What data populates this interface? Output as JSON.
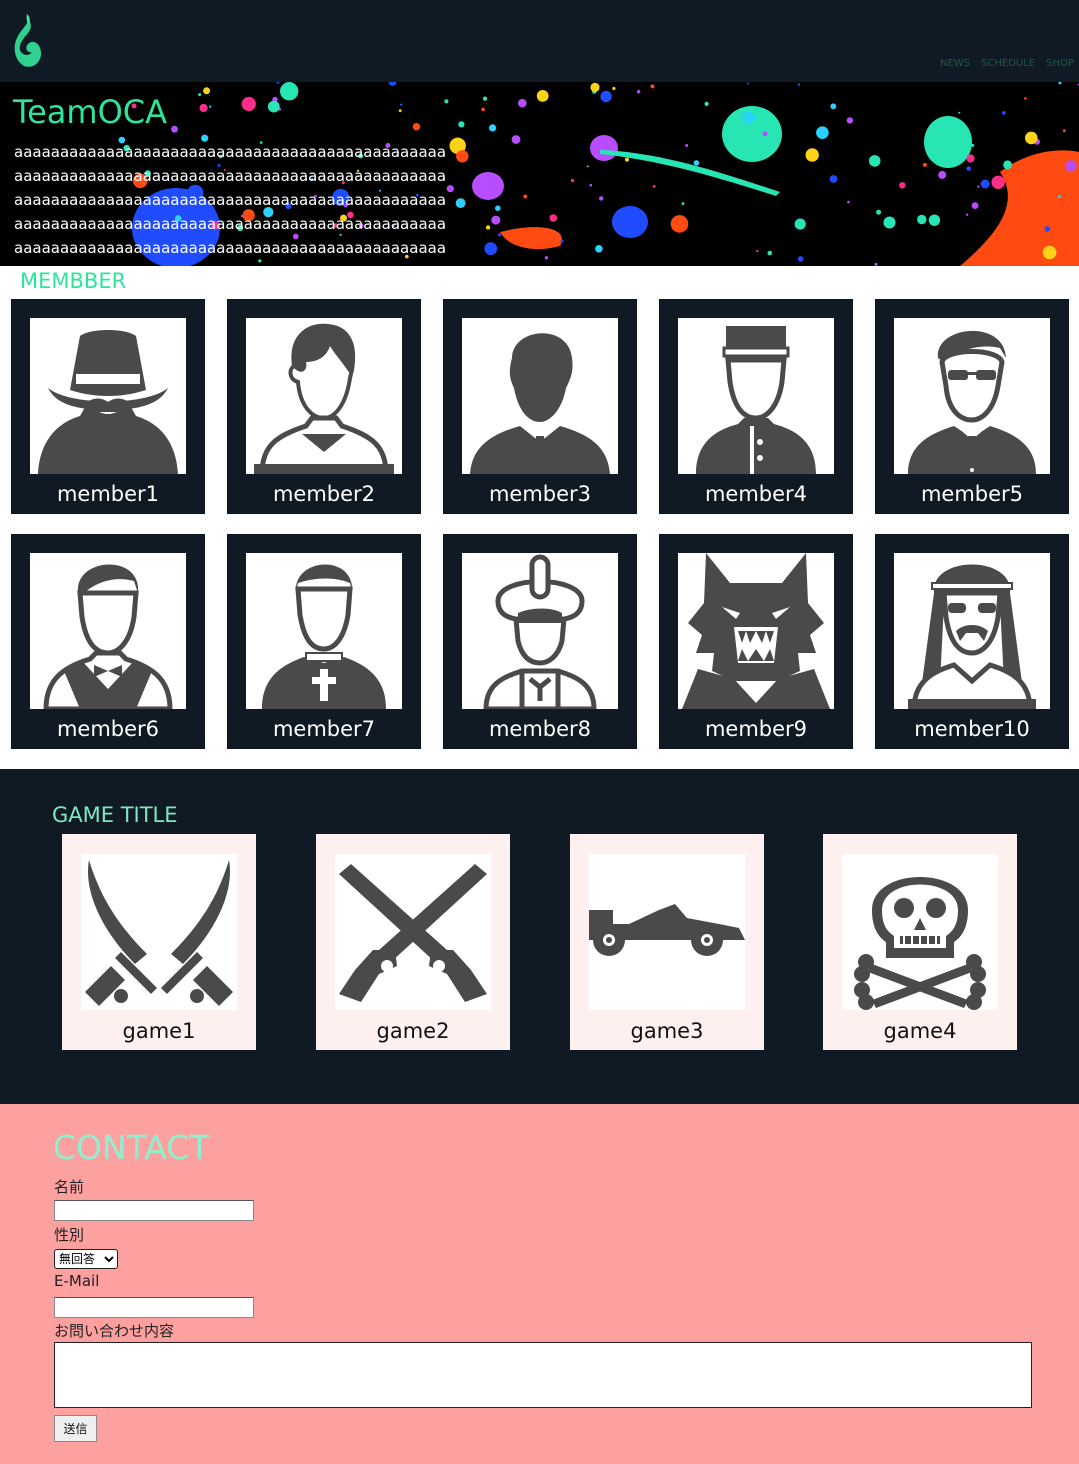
{
  "header": {
    "nav": [
      "NEWS",
      "SCHEDULE",
      "SHOP"
    ]
  },
  "hero": {
    "title": "TeamOCA",
    "lines": [
      "aaaaaaaaaaaaaaaaaaaaaaaaaaaaaaaaaaaaaaaaaaaaaaa",
      "aaaaaaaaaaaaaaaaaaaaaaaaaaaaaaaaaaaaaaaaaaaaaaa",
      "aaaaaaaaaaaaaaaaaaaaaaaaaaaaaaaaaaaaaaaaaaaaaaa",
      "aaaaaaaaaaaaaaaaaaaaaaaaaaaaaaaaaaaaaaaaaaaaaaa",
      "aaaaaaaaaaaaaaaaaaaaaaaaaaaaaaaaaaaaaaaaaaaaaaa"
    ]
  },
  "members": {
    "heading": "MEMBBER",
    "items": [
      {
        "name": "member1",
        "icon": "spy-icon"
      },
      {
        "name": "member2",
        "icon": "young-man-icon"
      },
      {
        "name": "member3",
        "icon": "businessman-icon"
      },
      {
        "name": "member4",
        "icon": "student-icon"
      },
      {
        "name": "member5",
        "icon": "sunglasses-man-icon"
      },
      {
        "name": "member6",
        "icon": "butler-icon"
      },
      {
        "name": "member7",
        "icon": "priest-icon"
      },
      {
        "name": "member8",
        "icon": "turban-man-icon"
      },
      {
        "name": "member9",
        "icon": "werewolf-icon"
      },
      {
        "name": "member10",
        "icon": "hippie-icon"
      }
    ]
  },
  "games": {
    "heading": "GAME TITLE",
    "items": [
      {
        "name": "game1",
        "icon": "crossed-swords-icon"
      },
      {
        "name": "game2",
        "icon": "crossed-guns-icon"
      },
      {
        "name": "game3",
        "icon": "race-car-icon"
      },
      {
        "name": "game4",
        "icon": "skull-crossbones-icon"
      }
    ]
  },
  "contact": {
    "heading": "CONTACT",
    "name_label": "名前",
    "name_value": "",
    "gender_label": "性別",
    "gender_selected": "無回答",
    "email_label": "E-Mail",
    "email_value": "",
    "message_label": "お問い合わせ内容",
    "message_value": "",
    "submit_label": "送信"
  },
  "colors": {
    "dark_navy": "#101a24",
    "accent_green": "#2ee59a",
    "contact_pink": "#fda0a0",
    "icon_gray": "#4a4a4a"
  }
}
